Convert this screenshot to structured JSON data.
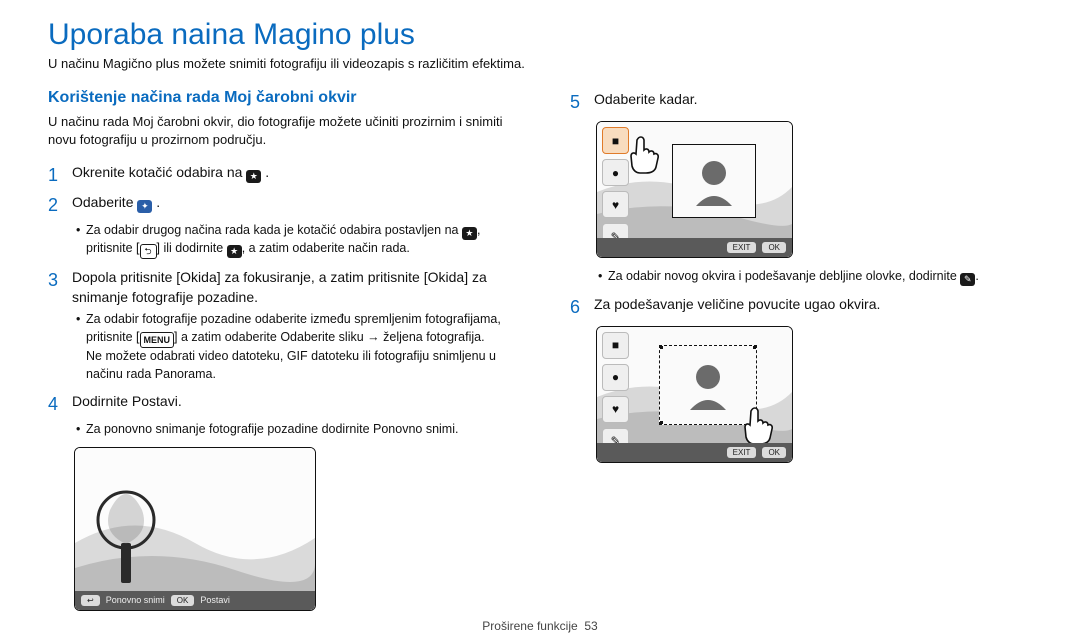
{
  "page_title": "Uporaba naina Magino plus",
  "intro": "U načinu Magično plus možete snimiti fotografiju ili videozapis s različitim efektima.",
  "section_title": "Korištenje načina rada Moj čarobni okvir",
  "section_sub": "U načinu rada Moj čarobni okvir, dio fotografije možete učiniti prozirnim i snimiti novu fotografiju u prozirnom području.",
  "steps": {
    "n1": "1",
    "s1_a": "Okrenite kotačić odabira na ",
    "s1_b": ".",
    "n2": "2",
    "s2_a": "Odaberite ",
    "s2_b": ".",
    "b2_line1": "Za odabir drugog načina rada kada je kotačić odabira postavljen na ",
    "b2_line1b": ",",
    "b2_line2a": "pritisnite [",
    "b2_line2b": "] ili dodirnite ",
    "b2_line2c": ", a zatim odaberite način rada.",
    "n3": "3",
    "s3_a": "Dopola pritisnite [",
    "s3_okida1": "Okida",
    "s3_b": "] za fokusiranje, a zatim pritisnite [",
    "s3_okida2": "Okida",
    "s3_c": "] za snimanje fotografije pozadine.",
    "b3_l1": "Za odabir fotografije pozadine odaberite između spremljenim fotografijama,",
    "b3_l2a": "pritisnite [",
    "b3_l2b": "] a zatim odaberite ",
    "b3_l2_cmd": "Odaberite sliku",
    "b3_l2c": " → željena fotografija.",
    "b3_l3": "Ne možete odabrati video datoteku, GIF datoteku ili fotografiju snimljenu u načinu rada Panorama.",
    "n4": "4",
    "s4_a": "Dodirnite ",
    "s4_cmd": "Postavi",
    "s4_b": ".",
    "b4a": "Za ponovno snimanje fotografije pozadine dodirnite ",
    "b4_cmd": "Ponovno snimi",
    "b4b": ".",
    "n5": "5",
    "s5": "Odaberite kadar.",
    "b5a": "Za odabir novog okvira i podešavanje debljine olovke, dodirnite ",
    "b5b": ".",
    "n6": "6",
    "s6": "Za podešavanje veličine povucite ugao okvira."
  },
  "fig1": {
    "back_key": "↩",
    "back_label": "Ponovno snimi",
    "ok_key": "OK",
    "ok_label": "Postavi"
  },
  "fig2": {
    "exit": "EXIT",
    "ok": "OK"
  },
  "fig3": {
    "exit": "EXIT",
    "ok": "OK"
  },
  "footer_label": "Proširene funkcije",
  "footer_page": "53"
}
